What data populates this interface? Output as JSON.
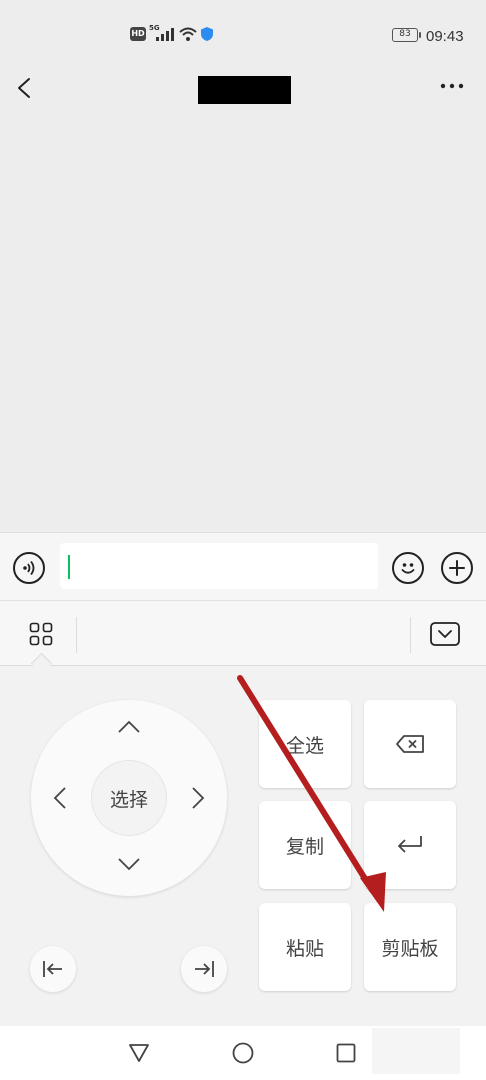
{
  "status_bar": {
    "time": "09:43",
    "battery": "83",
    "network_hd": "HD",
    "network_gen": "5G"
  },
  "title_bar": {
    "title": ""
  },
  "input_bar": {
    "message_value": "",
    "message_placeholder": ""
  },
  "keyboard": {
    "select_label": "选择",
    "keys": {
      "select_all": "全选",
      "copy": "复制",
      "paste": "粘贴",
      "clipboard": "剪贴板"
    }
  },
  "colors": {
    "accent": "#07c160",
    "annotation": "#b41e1e"
  },
  "icons": {
    "back": "chevron-left-icon",
    "more": "more-dots-icon",
    "voice": "voice-icon",
    "emoji": "emoji-icon",
    "add": "plus-icon",
    "grid": "grid-icon",
    "hide_keyboard": "keyboard-hide-icon",
    "backspace": "backspace-icon",
    "enter": "enter-icon",
    "line_start": "line-start-icon",
    "line_end": "line-end-icon",
    "nav_back": "triangle-back-icon",
    "nav_home": "circle-home-icon",
    "nav_recents": "square-recents-icon"
  }
}
